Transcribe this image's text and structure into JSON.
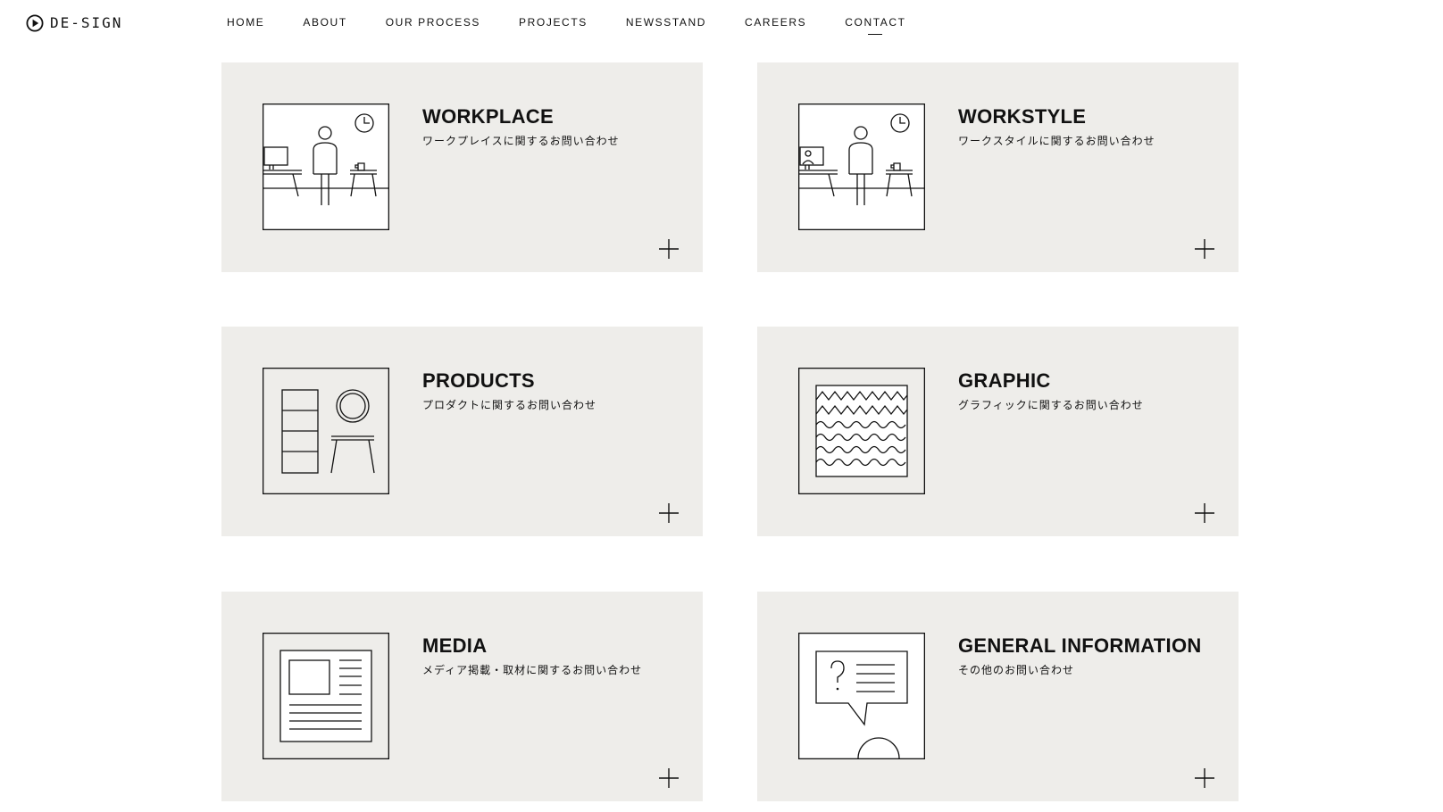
{
  "brand": {
    "name": "DE-SIGN",
    "logo_icon": "play-circle-icon"
  },
  "nav": {
    "items": [
      {
        "label": "HOME"
      },
      {
        "label": "ABOUT"
      },
      {
        "label": "OUR PROCESS"
      },
      {
        "label": "PROJECTS"
      },
      {
        "label": "NEWSSTAND"
      },
      {
        "label": "CAREERS"
      },
      {
        "label": "CONTACT"
      }
    ],
    "active": "CONTACT"
  },
  "cards": [
    {
      "title": "WORKPLACE",
      "subtitle": "ワークプレイスに関するお問い合わせ",
      "icon": "workplace-illustration-icon"
    },
    {
      "title": "WORKSTYLE",
      "subtitle": "ワークスタイルに関するお問い合わせ",
      "icon": "workstyle-illustration-icon"
    },
    {
      "title": "PRODUCTS",
      "subtitle": "プロダクトに関するお問い合わせ",
      "icon": "products-illustration-icon"
    },
    {
      "title": "GRAPHIC",
      "subtitle": "グラフィックに関するお問い合わせ",
      "icon": "graphic-illustration-icon"
    },
    {
      "title": "MEDIA",
      "subtitle": "メディア掲載・取材に関するお問い合わせ",
      "icon": "media-illustration-icon"
    },
    {
      "title": "GENERAL INFORMATION",
      "subtitle": "その他のお問い合わせ",
      "icon": "general-information-illustration-icon"
    }
  ],
  "expand_icon": "plus-icon",
  "colors": {
    "card_background": "#eeedea",
    "text": "#111111",
    "page_background": "#ffffff"
  }
}
